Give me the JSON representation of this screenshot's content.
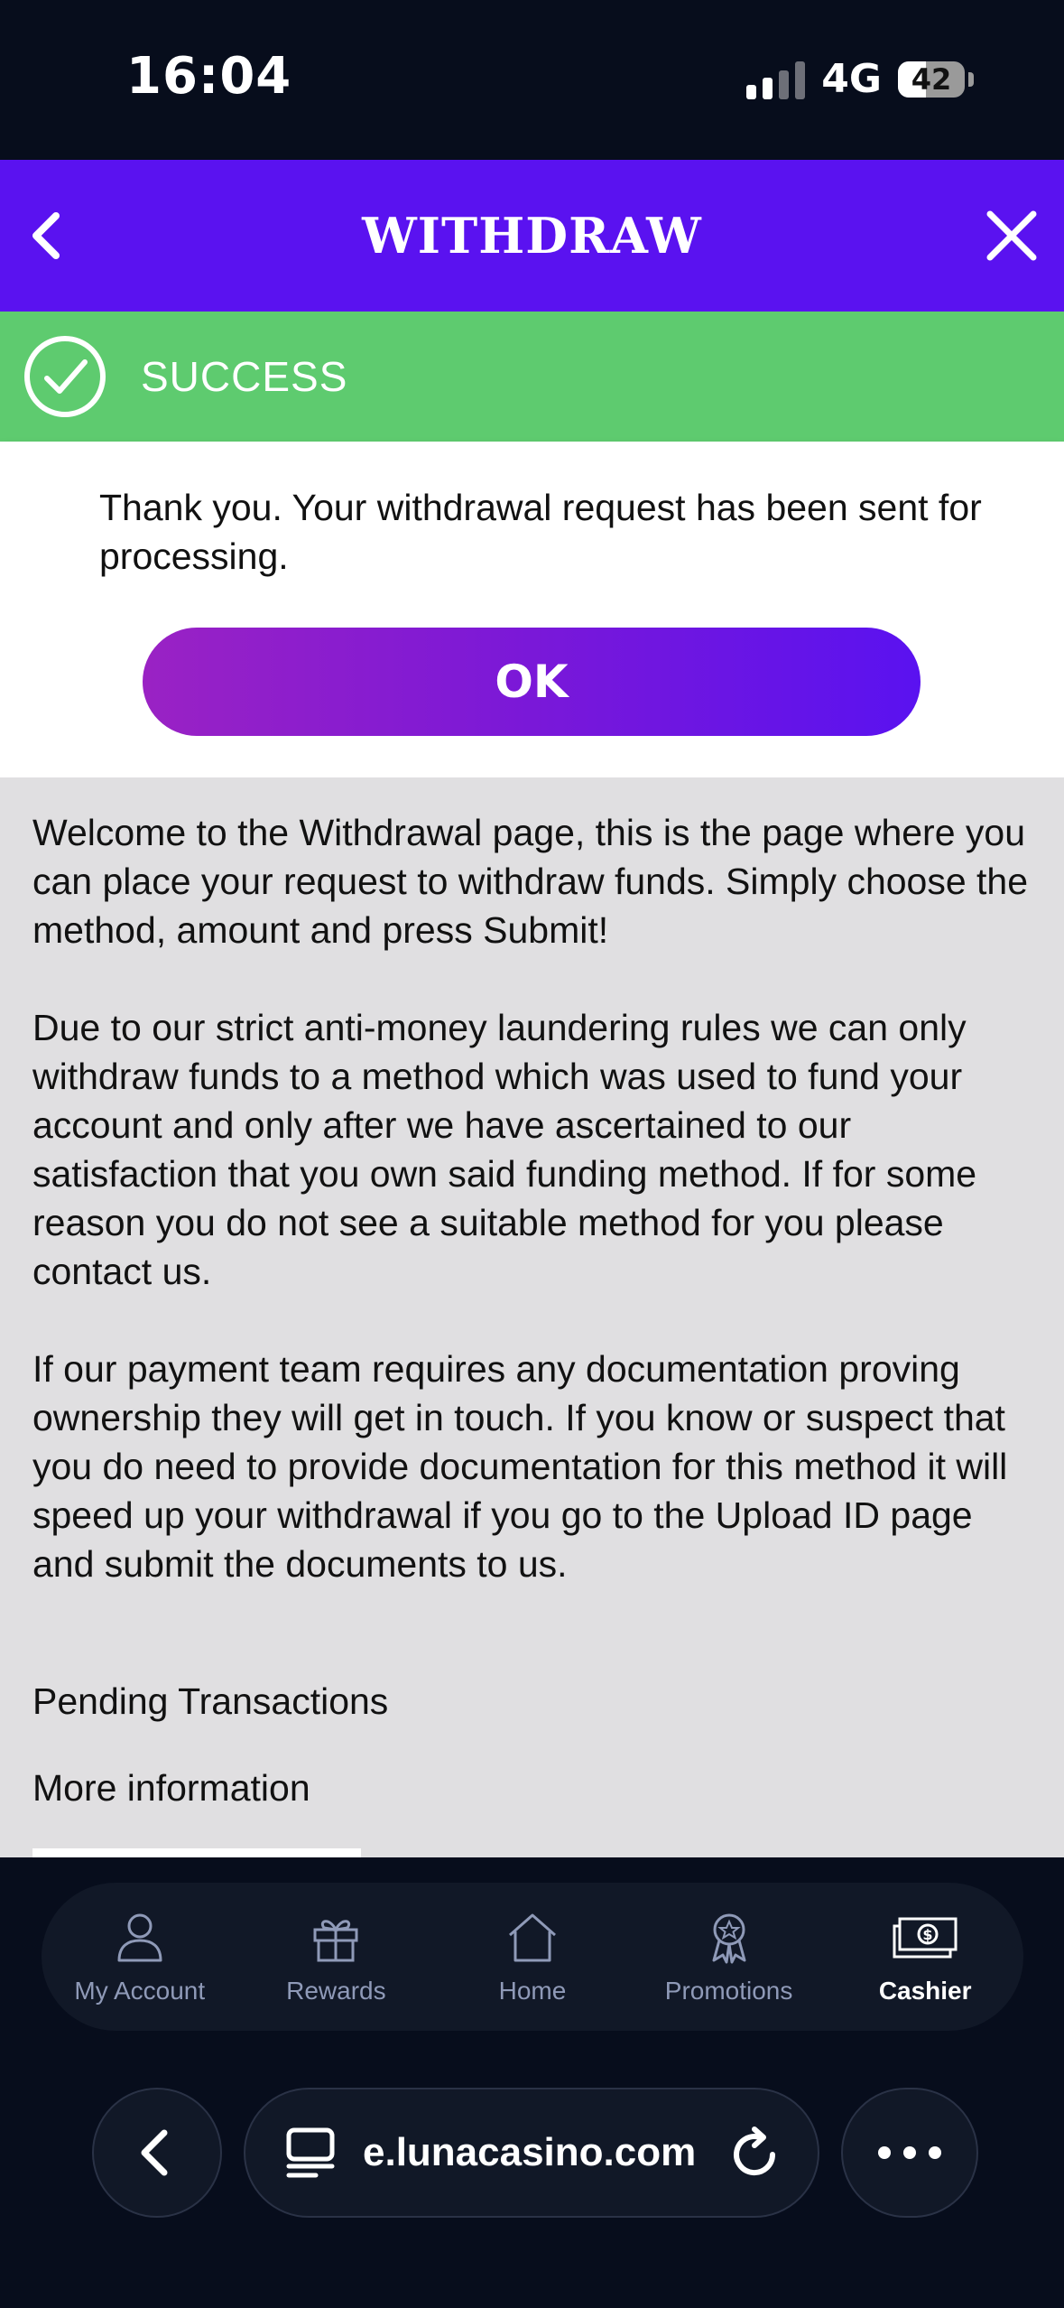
{
  "status_bar": {
    "time": "16:04",
    "network": "4G",
    "battery": "42",
    "battery_fraction": 0.42
  },
  "header": {
    "title": "WITHDRAW",
    "back_icon": "chevron-left-icon",
    "close_icon": "close-icon"
  },
  "success": {
    "label": "SUCCESS",
    "icon": "check-circle-icon",
    "color": "#5ecb6f"
  },
  "message": {
    "text": "Thank you. Your withdrawal request has been sent for processing.",
    "ok_label": "OK"
  },
  "content": {
    "paragraph_1": "Welcome to the Withdrawal page, this is the page where you can place your request to withdraw funds. Simply choose the method, amount and press Submit!",
    "paragraph_2": "Due to our strict anti-money laundering rules we can only withdraw funds to a method which was used to fund your account and only after we have ascertained to our satisfaction that you own said funding method. If for some reason you do not see a suitable method for you please contact us.",
    "paragraph_3": "If our payment team requires any documentation proving ownership they will get in touch. If you know or suspect that you do need to provide documentation for this method it will speed up your withdrawal if you go to the Upload ID page and submit the documents to us.",
    "pending_link": "Pending Transactions",
    "more_link": "More information"
  },
  "nav": {
    "items": [
      {
        "label": "My Account",
        "icon": "user-icon",
        "active": false
      },
      {
        "label": "Rewards",
        "icon": "gift-icon",
        "active": false
      },
      {
        "label": "Home",
        "icon": "home-icon",
        "active": false
      },
      {
        "label": "Promotions",
        "icon": "award-icon",
        "active": false
      },
      {
        "label": "Cashier",
        "icon": "cash-icon",
        "active": true
      }
    ]
  },
  "browser": {
    "url": "e.lunacasino.com",
    "back_icon": "chevron-left-icon",
    "tabs_icon": "tabs-icon",
    "reload_icon": "reload-icon",
    "more_icon": "more-icon"
  },
  "colors": {
    "header": "#5a12f0",
    "background_dark": "#070d1c",
    "content_bg": "#e0dfe1",
    "button_gradient_start": "#9a22c4",
    "button_gradient_end": "#5a12f0"
  }
}
